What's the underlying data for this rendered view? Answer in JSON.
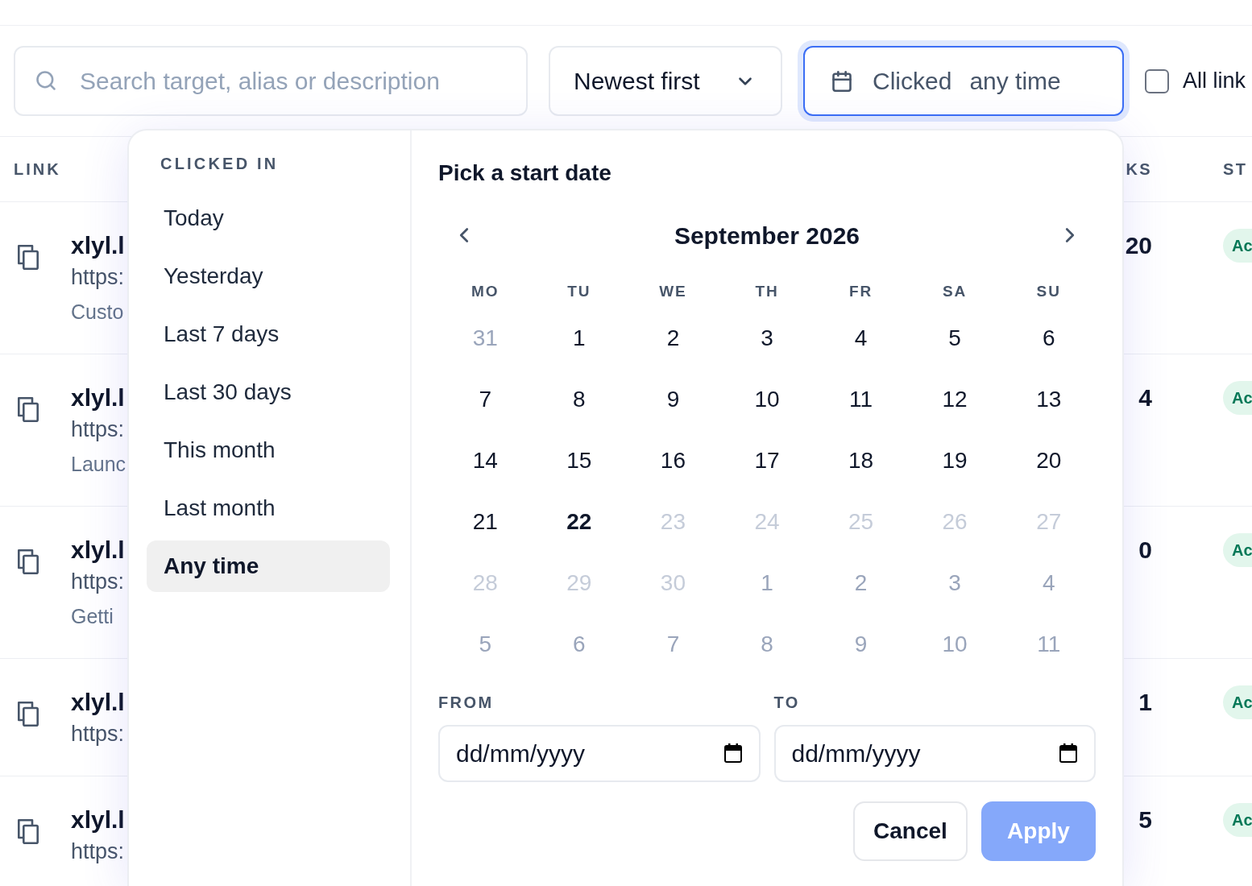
{
  "toolbar": {
    "search": {
      "placeholder": "Search target, alias or description"
    },
    "sort": {
      "value": "Newest first"
    },
    "date_filter": {
      "label": "Clicked",
      "value": "any time",
      "focused": true
    },
    "all_links": {
      "label": "All link",
      "checked": false
    }
  },
  "table": {
    "columns": [
      "LINK",
      "KS",
      "ST"
    ],
    "rows": [
      {
        "short_link": "xlyl.l",
        "target": "https:",
        "description": "Custo",
        "clicks": "20",
        "status": "Ac"
      },
      {
        "short_link": "xlyl.l",
        "target": "https:",
        "description": "Launc",
        "clicks": "4",
        "status": "Ac"
      },
      {
        "short_link": "xlyl.l",
        "target": "https:",
        "description": "Getti",
        "clicks": "0",
        "status": "Ac"
      },
      {
        "short_link": "xlyl.l",
        "target": "https:",
        "clicks": "1",
        "status": "Ac"
      },
      {
        "short_link": "xlyl.l",
        "target": "https:",
        "clicks": "5",
        "status": "Ac"
      }
    ]
  },
  "date_picker": {
    "presets_title": "CLICKED IN",
    "presets": [
      {
        "label": "Today",
        "selected": false
      },
      {
        "label": "Yesterday",
        "selected": false
      },
      {
        "label": "Last 7 days",
        "selected": false
      },
      {
        "label": "Last 30 days",
        "selected": false
      },
      {
        "label": "This month",
        "selected": false
      },
      {
        "label": "Last month",
        "selected": false
      },
      {
        "label": "Any time",
        "selected": true
      }
    ],
    "title": "Pick a start date",
    "month": "September 2026",
    "weekdays": [
      "MO",
      "TU",
      "WE",
      "TH",
      "FR",
      "SA",
      "SU"
    ],
    "weeks": [
      {
        "days": [
          {
            "label": "31",
            "outside_month": true,
            "disabled": false,
            "today": false
          },
          {
            "label": "1",
            "outside_month": false,
            "disabled": false,
            "today": false
          },
          {
            "label": "2",
            "outside_month": false,
            "disabled": false,
            "today": false
          },
          {
            "label": "3",
            "outside_month": false,
            "disabled": false,
            "today": false
          },
          {
            "label": "4",
            "outside_month": false,
            "disabled": false,
            "today": false
          },
          {
            "label": "5",
            "outside_month": false,
            "disabled": false,
            "today": false
          },
          {
            "label": "6",
            "outside_month": false,
            "disabled": false,
            "today": false
          }
        ]
      },
      {
        "days": [
          {
            "label": "7",
            "outside_month": false,
            "disabled": false,
            "today": false
          },
          {
            "label": "8",
            "outside_month": false,
            "disabled": false,
            "today": false
          },
          {
            "label": "9",
            "outside_month": false,
            "disabled": false,
            "today": false
          },
          {
            "label": "10",
            "outside_month": false,
            "disabled": false,
            "today": false
          },
          {
            "label": "11",
            "outside_month": false,
            "disabled": false,
            "today": false
          },
          {
            "label": "12",
            "outside_month": false,
            "disabled": false,
            "today": false
          },
          {
            "label": "13",
            "outside_month": false,
            "disabled": false,
            "today": false
          }
        ]
      },
      {
        "days": [
          {
            "label": "14",
            "outside_month": false,
            "disabled": false,
            "today": false
          },
          {
            "label": "15",
            "outside_month": false,
            "disabled": false,
            "today": false
          },
          {
            "label": "16",
            "outside_month": false,
            "disabled": false,
            "today": false
          },
          {
            "label": "17",
            "outside_month": false,
            "disabled": false,
            "today": false
          },
          {
            "label": "18",
            "outside_month": false,
            "disabled": false,
            "today": false
          },
          {
            "label": "19",
            "outside_month": false,
            "disabled": false,
            "today": false
          },
          {
            "label": "20",
            "outside_month": false,
            "disabled": false,
            "today": false
          }
        ]
      },
      {
        "days": [
          {
            "label": "21",
            "outside_month": false,
            "disabled": false,
            "today": false
          },
          {
            "label": "22",
            "outside_month": false,
            "disabled": false,
            "today": true
          },
          {
            "label": "23",
            "outside_month": false,
            "disabled": true,
            "today": false
          },
          {
            "label": "24",
            "outside_month": false,
            "disabled": true,
            "today": false
          },
          {
            "label": "25",
            "outside_month": false,
            "disabled": true,
            "today": false
          },
          {
            "label": "26",
            "outside_month": false,
            "disabled": true,
            "today": false
          },
          {
            "label": "27",
            "outside_month": false,
            "disabled": true,
            "today": false
          }
        ]
      },
      {
        "days": [
          {
            "label": "28",
            "outside_month": false,
            "disabled": true,
            "today": false
          },
          {
            "label": "29",
            "outside_month": false,
            "disabled": true,
            "today": false
          },
          {
            "label": "30",
            "outside_month": false,
            "disabled": true,
            "today": false
          },
          {
            "label": "1",
            "outside_month": true,
            "disabled": false,
            "today": false
          },
          {
            "label": "2",
            "outside_month": true,
            "disabled": false,
            "today": false
          },
          {
            "label": "3",
            "outside_month": true,
            "disabled": false,
            "today": false
          },
          {
            "label": "4",
            "outside_month": true,
            "disabled": false,
            "today": false
          }
        ]
      },
      {
        "days": [
          {
            "label": "5",
            "outside_month": true,
            "disabled": false,
            "today": false
          },
          {
            "label": "6",
            "outside_month": true,
            "disabled": false,
            "today": false
          },
          {
            "label": "7",
            "outside_month": true,
            "disabled": false,
            "today": false
          },
          {
            "label": "8",
            "outside_month": true,
            "disabled": false,
            "today": false
          },
          {
            "label": "9",
            "outside_month": true,
            "disabled": false,
            "today": false
          },
          {
            "label": "10",
            "outside_month": true,
            "disabled": false,
            "today": false
          },
          {
            "label": "11",
            "outside_month": true,
            "disabled": false,
            "today": false
          }
        ]
      }
    ],
    "from": {
      "label": "FROM",
      "placeholder": "dd/mm/yyyy"
    },
    "to": {
      "label": "TO",
      "placeholder": "dd/mm/yyyy"
    },
    "buttons": [
      {
        "label": "Cancel",
        "kind": "secondary",
        "disabled": false
      },
      {
        "label": "Apply",
        "kind": "primary",
        "disabled": true
      }
    ]
  }
}
